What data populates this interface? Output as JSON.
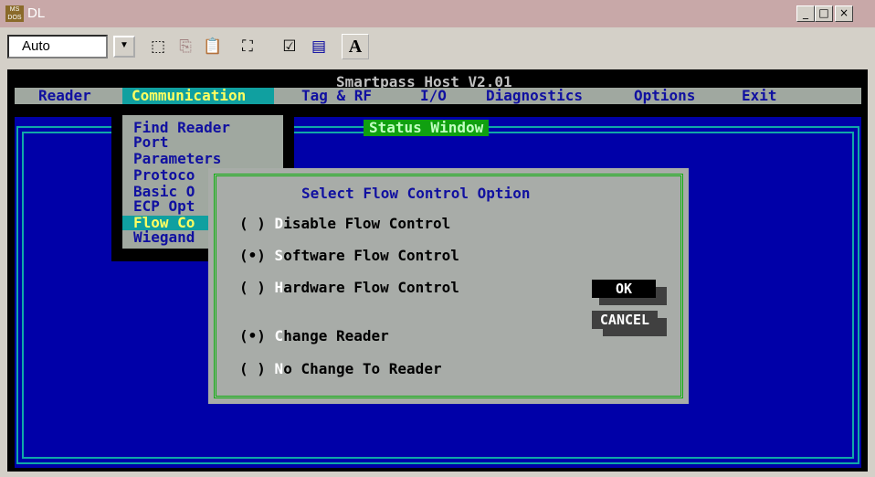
{
  "window": {
    "title": "DL",
    "icon_text": "MS DOS",
    "min_glyph": "_",
    "max_glyph": "□",
    "close_glyph": "×"
  },
  "toolbar": {
    "font_value": "Auto",
    "dropdown_glyph": "▼",
    "letter_button": "A"
  },
  "app": {
    "title": "Smartpass Host V2.01"
  },
  "menu": {
    "reader": "Reader",
    "communication": "Communication",
    "tag_rf": "Tag & RF",
    "io": "I/O",
    "diagnostics": "Diagnostics",
    "options": "Options",
    "exit": "Exit"
  },
  "status_window": "Status Window",
  "dropdown": {
    "items": [
      "Find Reader",
      "Port",
      "Parameters",
      "Protoco",
      "Basic O",
      "ECP Opt",
      "Flow Co",
      "Wiegand"
    ]
  },
  "dialog": {
    "title": "Select Flow Control Option",
    "options": [
      {
        "mark": "( )",
        "hot": "D",
        "rest": "isable Flow Control"
      },
      {
        "mark": "(•)",
        "hot": "S",
        "rest": "oftware Flow Control"
      },
      {
        "mark": "( )",
        "hot": "H",
        "rest": "ardware Flow Control"
      },
      {
        "mark": "(•)",
        "hot": "C",
        "rest": "hange Reader"
      },
      {
        "mark": "( )",
        "hot": "N",
        "rest": "o Change To Reader"
      }
    ],
    "ok": "OK",
    "cancel": "CANCEL"
  }
}
